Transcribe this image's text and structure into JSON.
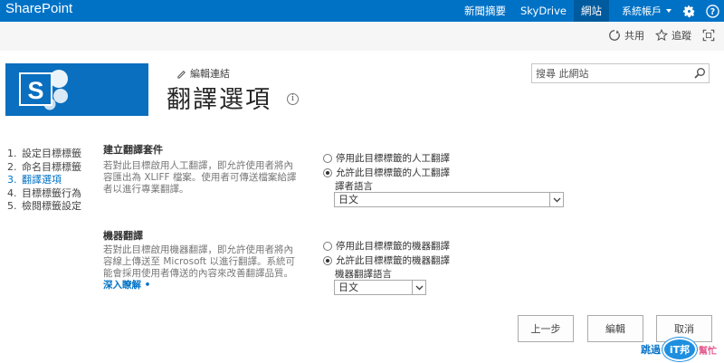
{
  "suite": {
    "brand": "SharePoint",
    "links": [
      "新聞摘要",
      "SkyDrive",
      "網站"
    ],
    "active_link": "網站",
    "account": "系統帳戶"
  },
  "ribbon": {
    "share_label": "共用",
    "follow_label": "追蹤"
  },
  "header": {
    "edit_links": "編輯連結",
    "title": "翻譯選項",
    "search_placeholder": "搜尋 此網站"
  },
  "leftnav": {
    "items": [
      {
        "num": "1.",
        "label": "設定目標標籤"
      },
      {
        "num": "2.",
        "label": "命名目標標籤"
      },
      {
        "num": "3.",
        "label": "翻譯選項"
      },
      {
        "num": "4.",
        "label": "目標標籤行為"
      },
      {
        "num": "5.",
        "label": "檢閱標籤設定"
      }
    ],
    "current_index": 2
  },
  "human": {
    "title": "建立翻譯套件",
    "desc": "若對此目標啟用人工翻譯，即允許使用者將內容匯出為 XLIFF 檔案。使用者可傳送檔案給譯者以進行專業翻譯。",
    "opt_disable": "停用此目標標籤的人工翻譯",
    "opt_enable": "允許此目標標籤的人工翻譯",
    "lang_label": "譯者語言",
    "lang_value": "日文"
  },
  "machine": {
    "title": "機器翻譯",
    "desc": "若對此目標啟用機器翻譯，即允許使用者將內容線上傳送至 Microsoft 以進行翻譯。系統可能會採用使用者傳送的內容來改善翻譯品質。",
    "learn_more": "深入瞭解 •",
    "opt_disable": "停用此目標標籤的機器翻譯",
    "opt_enable": "允許此目標標籤的機器翻譯",
    "lang_label": "機器翻譯語言",
    "lang_value": "日文"
  },
  "buttons": {
    "prev": "上一步",
    "edit": "編輯",
    "cancel": "取消"
  },
  "watermark": {
    "prefix": "跳過",
    "badge": "iT邦",
    "suffix": "幫忙"
  }
}
